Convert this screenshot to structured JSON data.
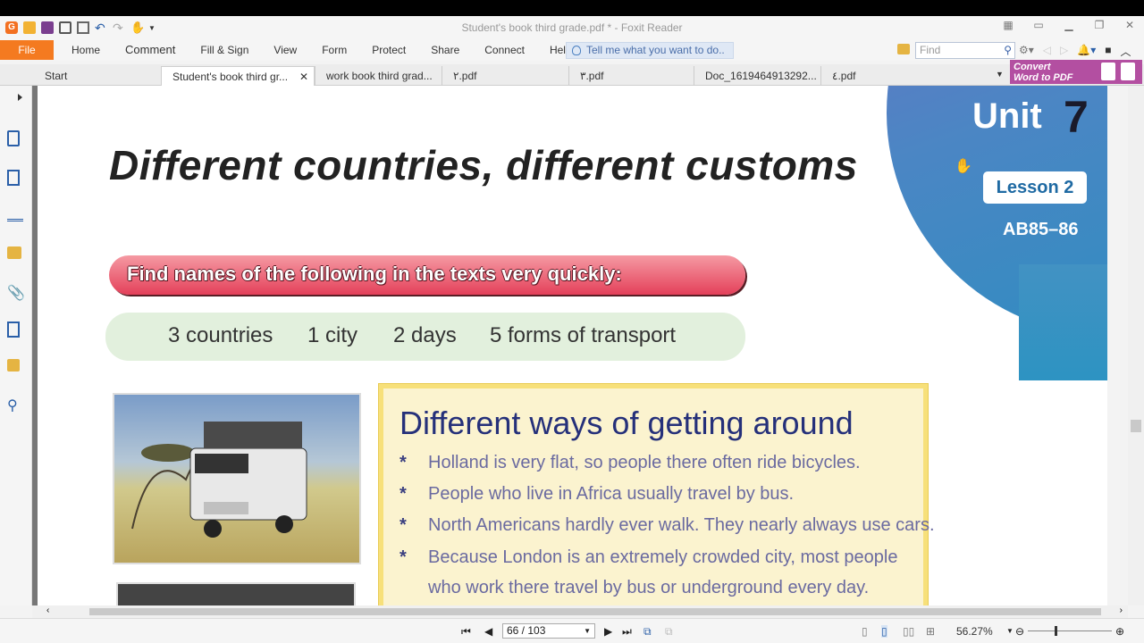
{
  "window": {
    "title": "Student's book third grade.pdf * - Foxit Reader"
  },
  "ribbon": {
    "file": "File",
    "menus": [
      "Home",
      "Comment",
      "Fill & Sign",
      "View",
      "Form",
      "Protect",
      "Share",
      "Connect",
      "Help"
    ],
    "tell_me": "Tell me what you want to do..",
    "find_placeholder": "Find"
  },
  "tabs": [
    "Start",
    "Student's book third gr...",
    "work book third grad...",
    "٢.pdf",
    "٣.pdf",
    "Doc_1619464913292...",
    "٤.pdf"
  ],
  "convert": {
    "line1": "Convert",
    "line2": "Word to PDF"
  },
  "page": {
    "title": "Different countries, different customs",
    "instruction": "Find names of the following in the texts very quickly:",
    "items": [
      "3 countries",
      "1 city",
      "2 days",
      "5 forms of transport"
    ],
    "unit_label": "Unit",
    "unit_number": "7",
    "lesson": "Lesson 2",
    "ab_ref": "AB85–86",
    "box_title": "Different ways of getting around",
    "bullets": [
      "Holland is very flat, so people there often ride bicycles.",
      "People who live in Africa usually travel by bus.",
      "North Americans hardly ever walk. They nearly always use cars.",
      "Because London is an extremely crowded city, most people",
      "who work there travel by bus or underground every day."
    ],
    "bullet_mark": "*"
  },
  "status": {
    "page": "66 / 103",
    "zoom": "56.27%"
  },
  "colors": {
    "accent": "#f47a20",
    "pink": "#e4405a",
    "unit_blue": "#2a8ec0",
    "convert": "#b34fa1"
  }
}
